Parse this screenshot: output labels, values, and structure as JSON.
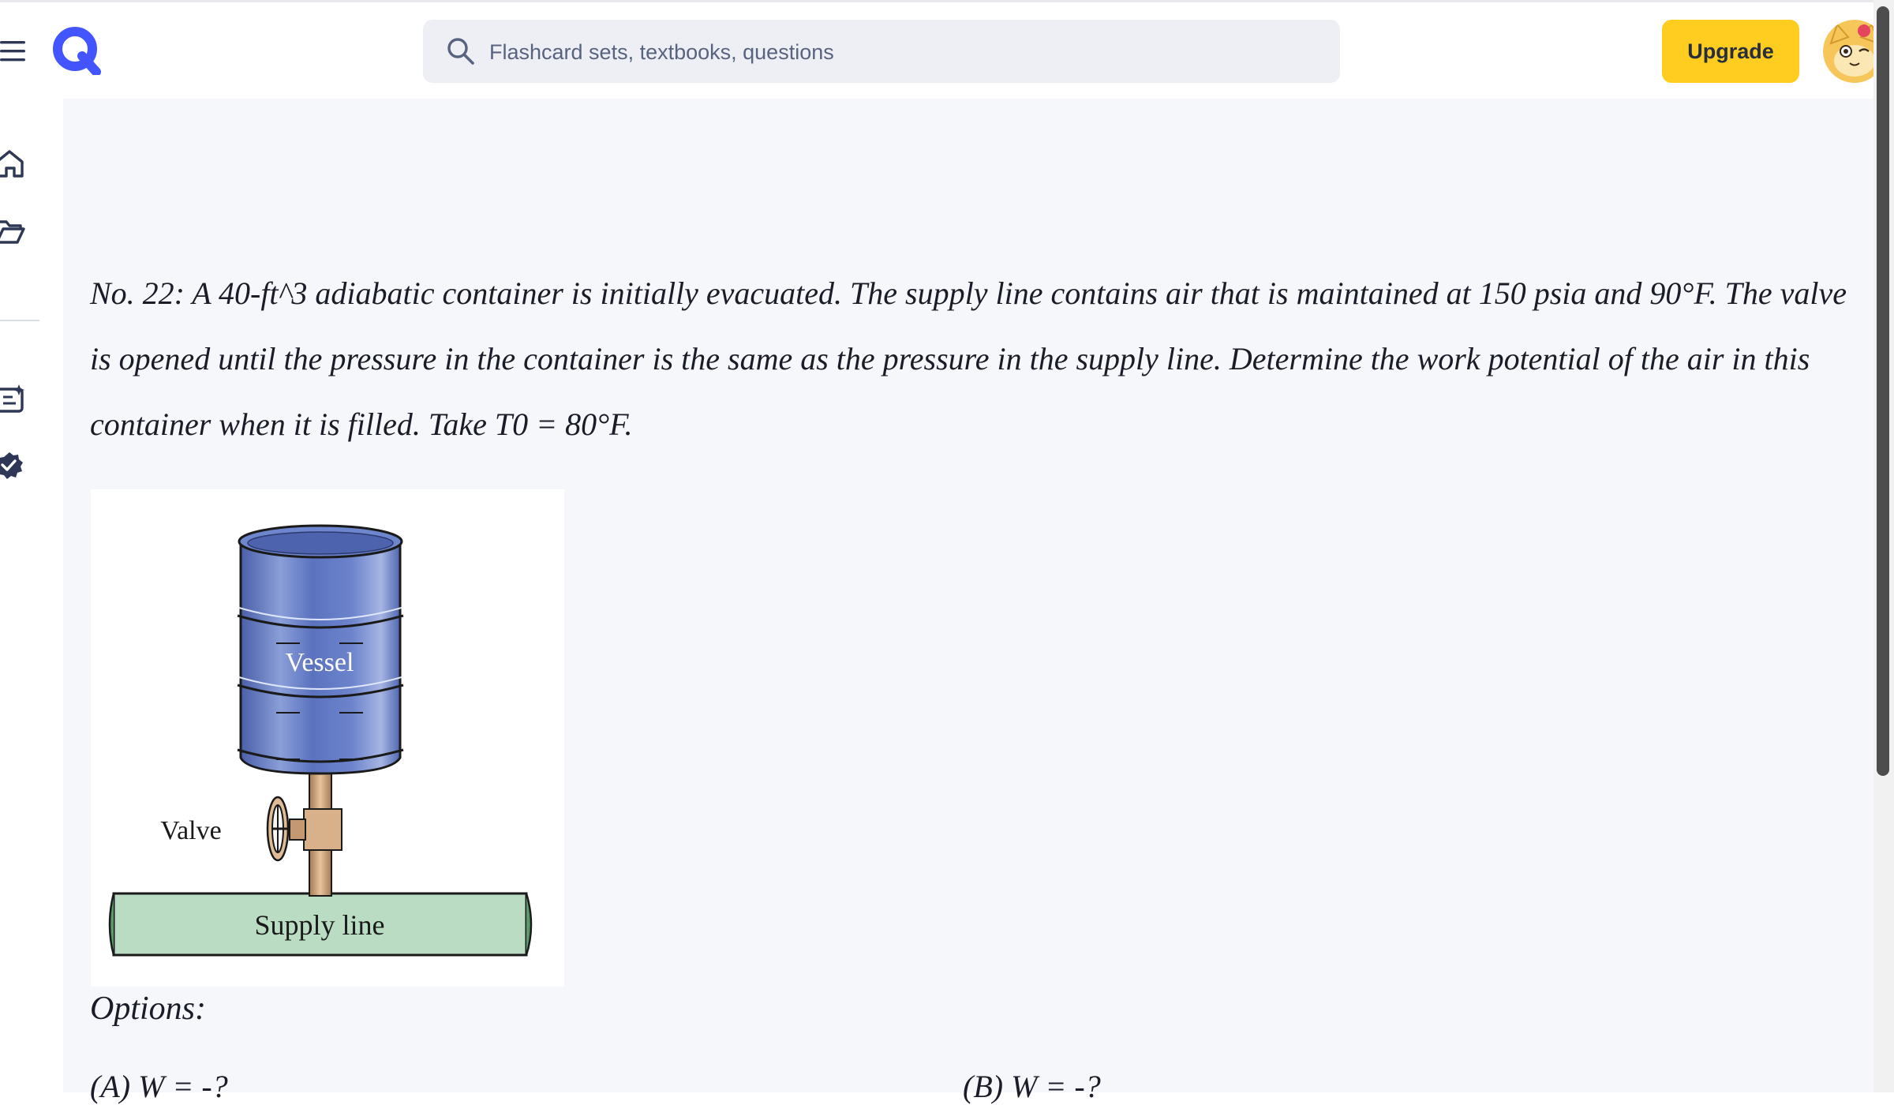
{
  "header": {
    "search_placeholder": "Flashcard sets, textbooks, questions",
    "upgrade_label": "Upgrade"
  },
  "question": {
    "number": "No. 22:",
    "text": "A 40-ft^3 adiabatic container is initially evacuated. The supply line contains air that is maintained at 150 psia and 90°F. The valve is opened until the pressure in the container is the same as the pressure in the supply line. Determine the work potential of the air in this container when it is filled. Take T0 = 80°F."
  },
  "figure": {
    "vessel_label": "Vessel",
    "valve_label": "Valve",
    "supply_label": "Supply line"
  },
  "options": {
    "title": "Options:",
    "a": "(A) W = -?",
    "b": "(B) W = -?"
  },
  "colors": {
    "accent": "#4255ff",
    "upgrade": "#ffcd1f",
    "background": "#f6f7fb",
    "vessel": "#5f78c2",
    "supply_line": "#b9dcc3",
    "pipe": "#d4ad86"
  },
  "icons": {
    "menu": "hamburger-menu-icon",
    "logo": "quizlet-q-logo",
    "search": "magnifier-icon",
    "home": "home-icon",
    "folder": "folder-icon",
    "flashcards": "flashcards-sparkle-icon",
    "verified": "verified-badge-icon"
  }
}
